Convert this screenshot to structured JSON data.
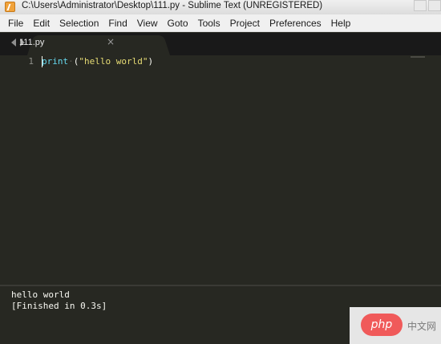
{
  "window": {
    "title": "C:\\Users\\Administrator\\Desktop\\111.py - Sublime Text (UNREGISTERED)",
    "app_icon": "sublime-text-icon"
  },
  "menubar": {
    "items": [
      "File",
      "Edit",
      "Selection",
      "Find",
      "View",
      "Goto",
      "Tools",
      "Project",
      "Preferences",
      "Help"
    ]
  },
  "tabs": {
    "nav_left_icon": "tab-nav-left-icon",
    "nav_right_icon": "tab-nav-right-icon",
    "items": [
      {
        "label": "111.py",
        "close": "×"
      }
    ]
  },
  "editor": {
    "lines": [
      {
        "number": "1",
        "tokens": {
          "fn": "print",
          "space": "·",
          "open": "(",
          "string": "\"hello world\"",
          "close": ")"
        }
      }
    ]
  },
  "output": {
    "lines": [
      "hello world",
      "[Finished in 0.3s]"
    ]
  },
  "watermark": {
    "badge": "php",
    "text": "中文网"
  },
  "colors": {
    "editor_bg": "#272822",
    "tabstrip_bg": "#191919",
    "function": "#66d9ef",
    "string": "#e6db74",
    "text": "#f8f8f2",
    "line_number": "#8f908a"
  }
}
